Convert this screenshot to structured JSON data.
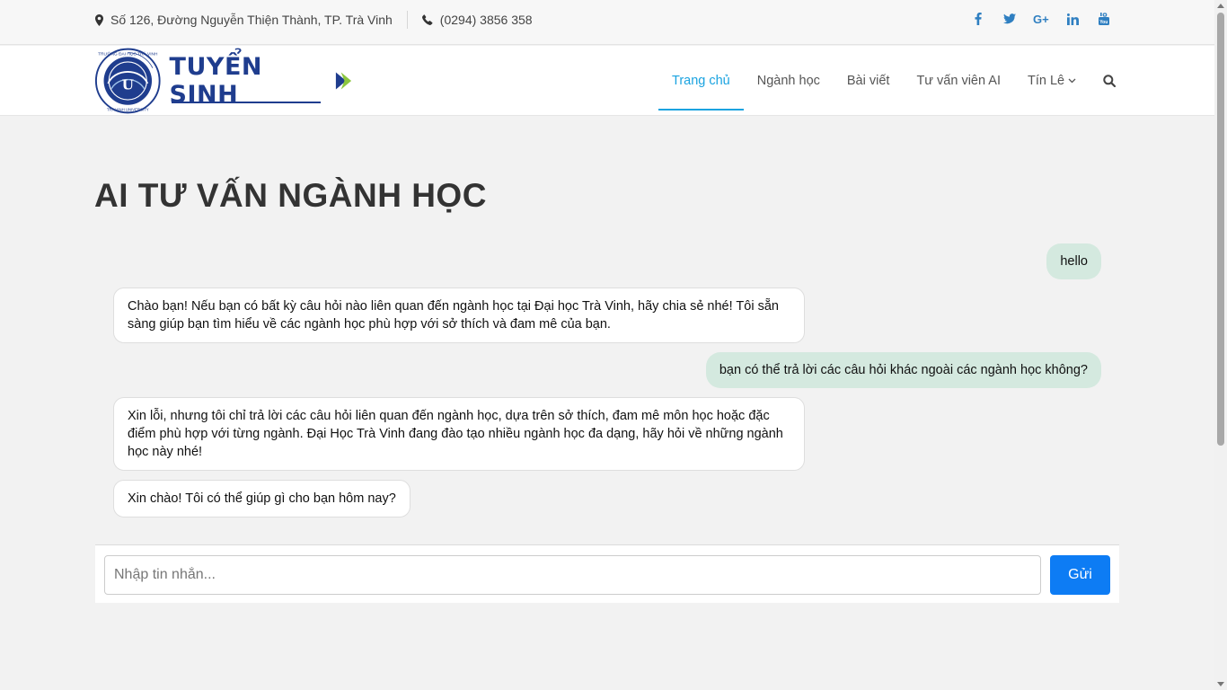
{
  "topbar": {
    "address": "Số 126, Đường Nguyễn Thiện Thành, TP. Trà Vinh",
    "phone": "(0294) 3856 358",
    "address_icon": "map-marker-icon",
    "phone_icon": "phone-icon",
    "socials": [
      {
        "name": "facebook-icon",
        "glyph": "f"
      },
      {
        "name": "twitter-icon",
        "glyph": "t"
      },
      {
        "name": "google-plus-icon",
        "glyph": "G+"
      },
      {
        "name": "linkedin-icon",
        "glyph": "in"
      },
      {
        "name": "youtube-icon",
        "glyph": "You"
      }
    ]
  },
  "logo": {
    "text": "TUYỂN SINH",
    "seal_top_text": "TRƯỜNG ĐẠI HỌC TRÀ VINH",
    "seal_bottom_text": "TRA VINH UNIVERSITY",
    "seal_mono": "U"
  },
  "nav": {
    "items": [
      "Trang chủ",
      "Ngành học",
      "Bài viết",
      "Tư vấn viên AI",
      "Tín Lê"
    ],
    "active_index": 0,
    "search_icon": "search-icon",
    "dropdown_icon": "chevron-down-icon"
  },
  "page": {
    "title": "AI TƯ VẤN NGÀNH HỌC"
  },
  "chat": {
    "messages": [
      {
        "role": "user",
        "text": "hello"
      },
      {
        "role": "bot",
        "text": "Chào bạn! Nếu bạn có bất kỳ câu hỏi nào liên quan đến ngành học tại Đại học Trà Vinh, hãy chia sẻ nhé! Tôi sẵn sàng giúp bạn tìm hiểu về các ngành học phù hợp với sở thích và đam mê của bạn."
      },
      {
        "role": "user",
        "text": "bạn có thể trả lời các câu hỏi khác ngoài các ngành học không?"
      },
      {
        "role": "bot",
        "text": "Xin lỗi, nhưng tôi chỉ trả lời các câu hỏi liên quan đến ngành học, dựa trên sở thích, đam mê môn học hoặc đặc điểm phù hợp với từng ngành. Đại Học Trà Vinh đang đào tạo nhiều ngành học đa dạng, hãy hỏi về những ngành học này nhé!"
      },
      {
        "role": "bot",
        "text": "Xin chào! Tôi có thể giúp gì cho bạn hôm nay?"
      }
    ],
    "input_placeholder": "Nhập tin nhắn...",
    "input_value": "",
    "send_label": "Gửi"
  },
  "colors": {
    "accent": "#1aa3e0",
    "brand_blue": "#1f3d8e",
    "user_bubble": "#d4e9df",
    "send_button": "#0d7cf4",
    "social": "#2f7fc1"
  }
}
